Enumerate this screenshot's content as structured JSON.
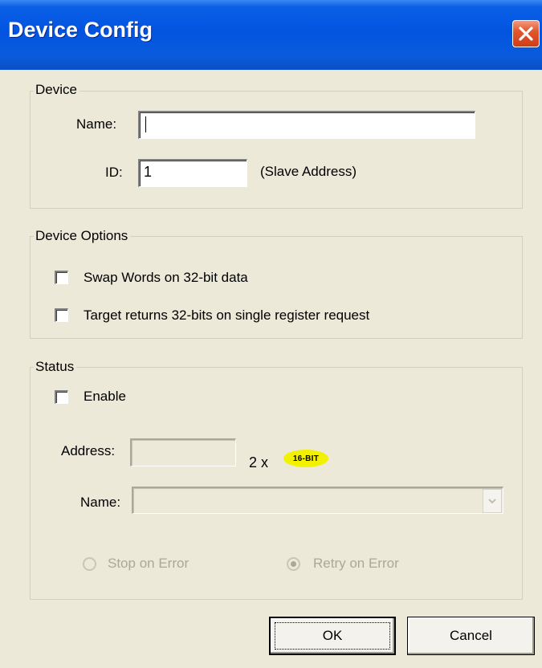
{
  "window": {
    "title": "Device Config"
  },
  "device_group": {
    "label": "Device",
    "name_label": "Name:",
    "name_value": "",
    "id_label": "ID:",
    "id_value": "1",
    "id_hint": "(Slave Address)"
  },
  "options_group": {
    "label": "Device Options",
    "swap_words_label": "Swap Words on 32-bit data",
    "swap_words_checked": false,
    "target_returns_label": "Target returns 32-bits on single register request",
    "target_returns_checked": false
  },
  "status_group": {
    "label": "Status",
    "enable_label": "Enable",
    "enable_checked": false,
    "address_label": "Address:",
    "address_value": "",
    "multiplier": "2 x",
    "bit_badge": "16-BIT",
    "name_label": "Name:",
    "name_value": "",
    "stop_on_error_label": "Stop on Error",
    "retry_on_error_label": "Retry on Error",
    "selected_radio": "Retry on Error"
  },
  "buttons": {
    "ok": "OK",
    "cancel": "Cancel"
  },
  "colors": {
    "title_bar": "#0254e0",
    "dialog_bg": "#ece9d8",
    "badge": "#f2f200",
    "close_button": "#e2572f",
    "disabled_text": "#aca899"
  },
  "icons": {
    "close": "close-icon",
    "dropdown": "chevron-down-icon"
  }
}
